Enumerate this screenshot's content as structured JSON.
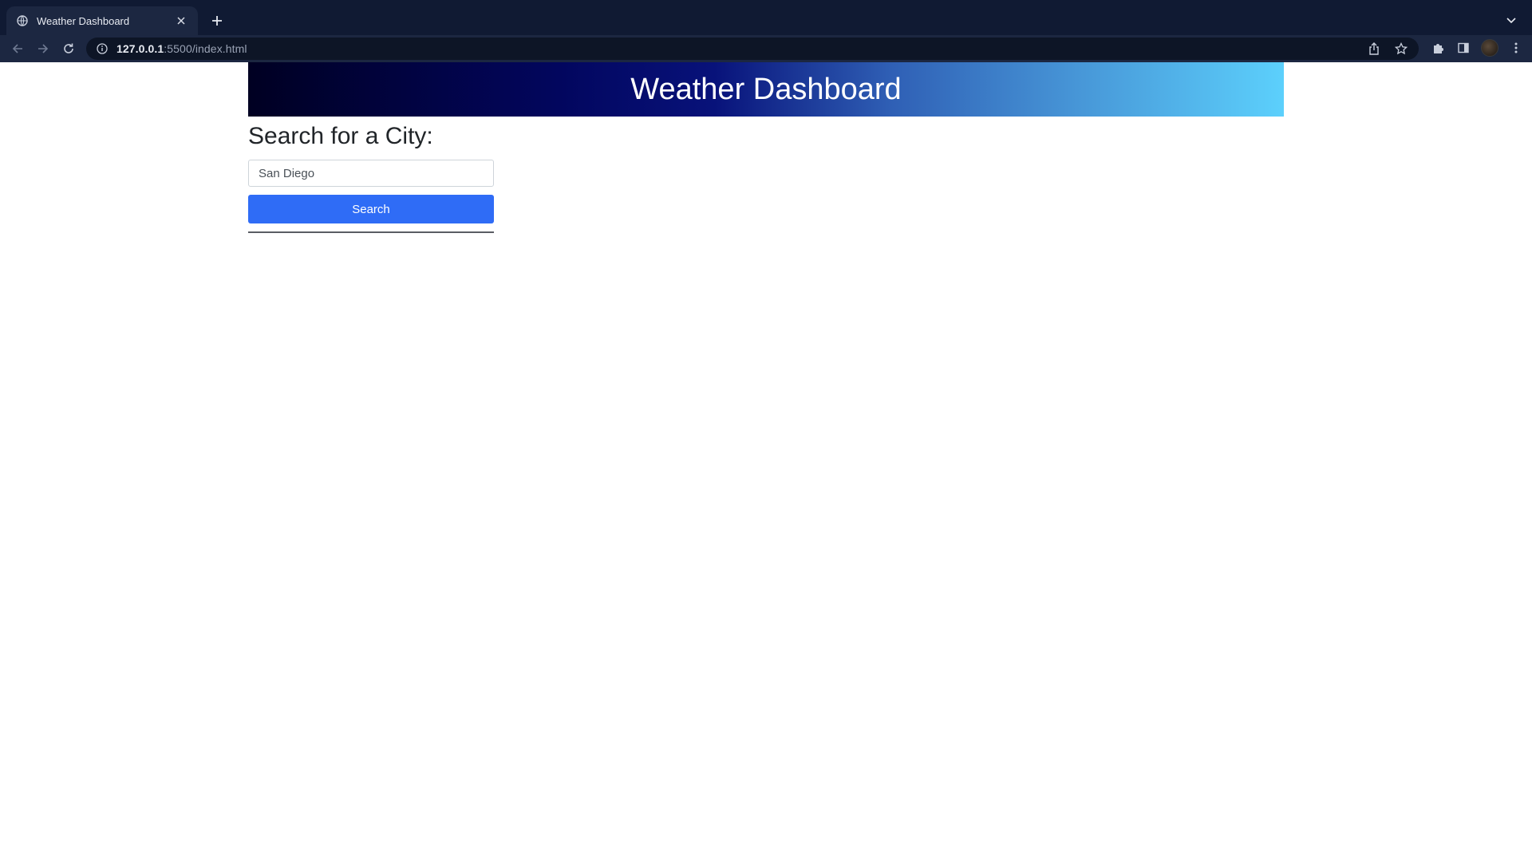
{
  "browser": {
    "tab_title": "Weather Dashboard",
    "url_host": "127.0.0.1",
    "url_path": ":5500/index.html",
    "icons": {
      "favicon": "globe-icon",
      "close": "close-icon",
      "new_tab": "plus-icon",
      "tab_list": "chevron-down-icon",
      "back": "arrow-left-icon",
      "forward": "arrow-right-icon",
      "reload": "reload-icon",
      "site_info": "info-icon",
      "share": "share-icon",
      "bookmark": "star-icon",
      "extensions": "puzzle-icon",
      "side_panel": "side-panel-icon",
      "profile": "avatar",
      "menu": "kebab-menu-icon"
    }
  },
  "page": {
    "header_title": "Weather Dashboard",
    "search_heading": "Search for a City:",
    "search_input_value": "San Diego",
    "search_button_label": "Search"
  },
  "colors": {
    "header_gradient_start": "#000022",
    "header_gradient_end": "#5cd0fc",
    "search_button": "#2f6cf6",
    "chrome_bg": "#101a33"
  }
}
